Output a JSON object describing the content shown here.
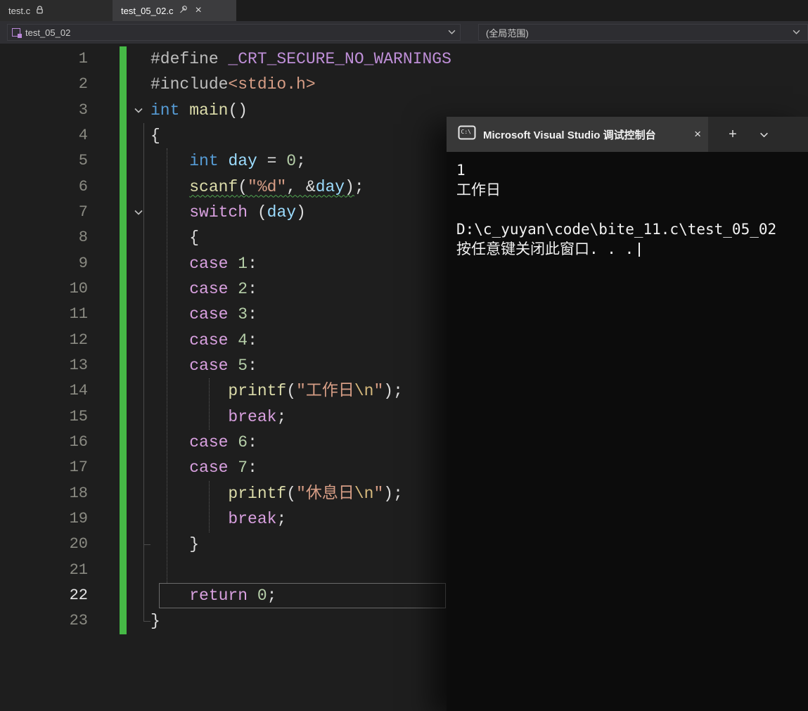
{
  "colors": {
    "change_bar_green": "#46b946",
    "console_background": "#0c0c0c",
    "editor_background": "#1e1e1e",
    "squiggle_green": "#52a852"
  },
  "tab_bar": {
    "tabs": [
      {
        "label": "test.c",
        "icon": "lock-icon",
        "active": false
      },
      {
        "label": "test_05_02.c",
        "icons": [
          "pin-icon",
          "close-icon"
        ],
        "active": true
      }
    ],
    "close_glyph": "×"
  },
  "navbar": {
    "file_scope": {
      "icon": "cpp-member-icon",
      "value": "test_05_02"
    },
    "member_scope": {
      "value": "(全局范围)"
    }
  },
  "editor": {
    "lines": [
      {
        "n": 1,
        "tokens": [
          [
            "pp",
            "#define "
          ],
          [
            "macro",
            "_CRT_SECURE_NO_WARNINGS"
          ]
        ]
      },
      {
        "n": 2,
        "tokens": [
          [
            "pp",
            "#include"
          ],
          [
            "str",
            "<stdio.h>"
          ]
        ]
      },
      {
        "n": 3,
        "fold": true,
        "tokens": [
          [
            "kw",
            "int"
          ],
          [
            "plain",
            " "
          ],
          [
            "fn",
            "main"
          ],
          [
            "plain",
            "()"
          ]
        ]
      },
      {
        "n": 4,
        "tokens": [
          [
            "plain",
            "{"
          ]
        ]
      },
      {
        "n": 5,
        "tokens": [
          [
            "plain",
            "    "
          ],
          [
            "kw",
            "int"
          ],
          [
            "plain",
            " "
          ],
          [
            "var",
            "day"
          ],
          [
            "plain",
            " = "
          ],
          [
            "num",
            "0"
          ],
          [
            "plain",
            ";"
          ]
        ]
      },
      {
        "n": 6,
        "tokens": [
          [
            "plain",
            "    "
          ],
          [
            "fn",
            "scanf",
            1
          ],
          [
            "plain",
            "(",
            1
          ],
          [
            "str",
            "\"%d\"",
            1
          ],
          [
            "plain",
            ", &",
            1
          ],
          [
            "var",
            "day",
            1
          ],
          [
            "plain",
            ")",
            1
          ],
          [
            "plain",
            ";"
          ]
        ]
      },
      {
        "n": 7,
        "fold": true,
        "tokens": [
          [
            "plain",
            "    "
          ],
          [
            "ctl",
            "switch"
          ],
          [
            "plain",
            " ("
          ],
          [
            "var",
            "day"
          ],
          [
            "plain",
            ")"
          ]
        ]
      },
      {
        "n": 8,
        "tokens": [
          [
            "plain",
            "    {"
          ]
        ]
      },
      {
        "n": 9,
        "tokens": [
          [
            "plain",
            "    "
          ],
          [
            "ctl",
            "case"
          ],
          [
            "plain",
            " "
          ],
          [
            "num",
            "1"
          ],
          [
            "plain",
            ":"
          ]
        ]
      },
      {
        "n": 10,
        "tokens": [
          [
            "plain",
            "    "
          ],
          [
            "ctl",
            "case"
          ],
          [
            "plain",
            " "
          ],
          [
            "num",
            "2"
          ],
          [
            "plain",
            ":"
          ]
        ]
      },
      {
        "n": 11,
        "tokens": [
          [
            "plain",
            "    "
          ],
          [
            "ctl",
            "case"
          ],
          [
            "plain",
            " "
          ],
          [
            "num",
            "3"
          ],
          [
            "plain",
            ":"
          ]
        ]
      },
      {
        "n": 12,
        "tokens": [
          [
            "plain",
            "    "
          ],
          [
            "ctl",
            "case"
          ],
          [
            "plain",
            " "
          ],
          [
            "num",
            "4"
          ],
          [
            "plain",
            ":"
          ]
        ]
      },
      {
        "n": 13,
        "tokens": [
          [
            "plain",
            "    "
          ],
          [
            "ctl",
            "case"
          ],
          [
            "plain",
            " "
          ],
          [
            "num",
            "5"
          ],
          [
            "plain",
            ":"
          ]
        ]
      },
      {
        "n": 14,
        "tokens": [
          [
            "plain",
            "        "
          ],
          [
            "fn",
            "printf"
          ],
          [
            "plain",
            "("
          ],
          [
            "str",
            "\"工作日"
          ],
          [
            "esc",
            "\\n"
          ],
          [
            "str",
            "\""
          ],
          [
            "plain",
            ");"
          ]
        ]
      },
      {
        "n": 15,
        "tokens": [
          [
            "plain",
            "        "
          ],
          [
            "ctl",
            "break"
          ],
          [
            "plain",
            ";"
          ]
        ]
      },
      {
        "n": 16,
        "tokens": [
          [
            "plain",
            "    "
          ],
          [
            "ctl",
            "case"
          ],
          [
            "plain",
            " "
          ],
          [
            "num",
            "6"
          ],
          [
            "plain",
            ":"
          ]
        ]
      },
      {
        "n": 17,
        "tokens": [
          [
            "plain",
            "    "
          ],
          [
            "ctl",
            "case"
          ],
          [
            "plain",
            " "
          ],
          [
            "num",
            "7"
          ],
          [
            "plain",
            ":"
          ]
        ]
      },
      {
        "n": 18,
        "tokens": [
          [
            "plain",
            "        "
          ],
          [
            "fn",
            "printf"
          ],
          [
            "plain",
            "("
          ],
          [
            "str",
            "\"休息日"
          ],
          [
            "esc",
            "\\n"
          ],
          [
            "str",
            "\""
          ],
          [
            "plain",
            ");"
          ]
        ]
      },
      {
        "n": 19,
        "tokens": [
          [
            "plain",
            "        "
          ],
          [
            "ctl",
            "break"
          ],
          [
            "plain",
            ";"
          ]
        ]
      },
      {
        "n": 20,
        "tokens": [
          [
            "plain",
            "    }"
          ]
        ]
      },
      {
        "n": 21,
        "tokens": []
      },
      {
        "n": 22,
        "current": true,
        "tokens": [
          [
            "plain",
            "    "
          ],
          [
            "ctl",
            "return"
          ],
          [
            "plain",
            " "
          ],
          [
            "num",
            "0"
          ],
          [
            "plain",
            ";"
          ]
        ]
      },
      {
        "n": 23,
        "tokens": [
          [
            "plain",
            "}"
          ]
        ]
      }
    ]
  },
  "console": {
    "title": "Microsoft Visual Studio 调试控制台",
    "icon": "console-icon",
    "icon_glyph": "C:\\",
    "close_glyph": "×",
    "new_tab_glyph": "+",
    "lines": [
      "1",
      "工作日",
      "",
      "D:\\c_yuyan\\code\\bite_11.c\\test_05_02",
      "按任意键关闭此窗口. . ."
    ]
  }
}
